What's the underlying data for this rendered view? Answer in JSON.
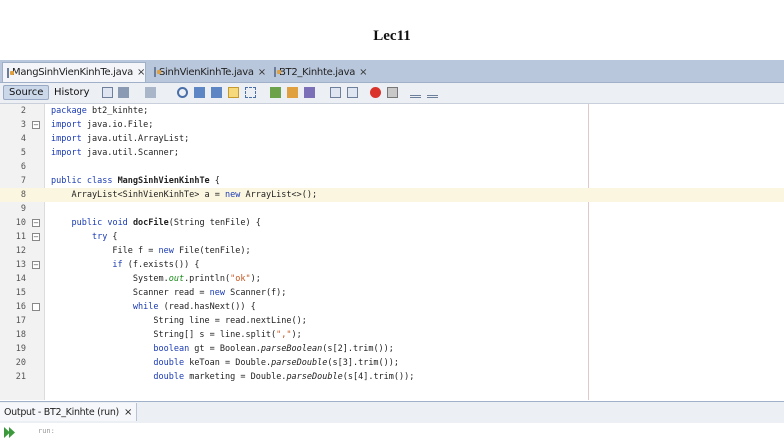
{
  "page_title": "Lec11",
  "tabs": [
    {
      "label": "MangSinhVienKinhTe.java",
      "active": true
    },
    {
      "label": "SinhVienKinhTe.java",
      "active": false
    },
    {
      "label": "BT2_Kinhte.java",
      "active": false
    }
  ],
  "close_glyph": "×",
  "toolbar": {
    "source_label": "Source",
    "history_label": "History"
  },
  "code_lines": [
    {
      "num": "2",
      "text": "package bt2_kinhte;",
      "fold": ""
    },
    {
      "num": "3",
      "text": "import java.io.File;",
      "fold": "-"
    },
    {
      "num": "4",
      "text": "import java.util.ArrayList;",
      "fold": ""
    },
    {
      "num": "5",
      "text": "import java.util.Scanner;",
      "fold": ""
    },
    {
      "num": "6",
      "text": "",
      "fold": ""
    },
    {
      "num": "7",
      "text": "public class MangSinhVienKinhTe {",
      "fold": ""
    },
    {
      "num": "8",
      "text": "    ArrayList<SinhVienKinhTe> a = new ArrayList<>();",
      "fold": ""
    },
    {
      "num": "9",
      "text": "",
      "fold": ""
    },
    {
      "num": "10",
      "text": "    public void docFile(String tenFile) {",
      "fold": "-"
    },
    {
      "num": "11",
      "text": "        try {",
      "fold": "-"
    },
    {
      "num": "12",
      "text": "            File f = new File(tenFile);",
      "fold": ""
    },
    {
      "num": "13",
      "text": "            if (f.exists()) {",
      "fold": "-"
    },
    {
      "num": "14",
      "text": "                System.out.println(\"ok\");",
      "fold": ""
    },
    {
      "num": "15",
      "text": "                Scanner read = new Scanner(f);",
      "fold": ""
    },
    {
      "num": "16",
      "text": "                while (read.hasNext()) {",
      "fold": "□"
    },
    {
      "num": "17",
      "text": "                    String line = read.nextLine();",
      "fold": ""
    },
    {
      "num": "18",
      "text": "                    String[] s = line.split(\",\");",
      "fold": ""
    },
    {
      "num": "19",
      "text": "                    boolean gt = Boolean.parseBoolean(s[2].trim());",
      "fold": ""
    },
    {
      "num": "20",
      "text": "                    double keToan = Double.parseDouble(s[3].trim());",
      "fold": ""
    },
    {
      "num": "21",
      "text": "                    double marketing = Double.parseDouble(s[4].trim());",
      "fold": ""
    }
  ],
  "highlighted_line": "8",
  "output": {
    "tab_label": "Output - BT2_Kinhte (run)",
    "text": "run:"
  },
  "colors": {
    "keyword": "#1b3bb5",
    "string": "#c5551f",
    "field": "#1a8a1a",
    "highlight": "#fbf6e0"
  }
}
